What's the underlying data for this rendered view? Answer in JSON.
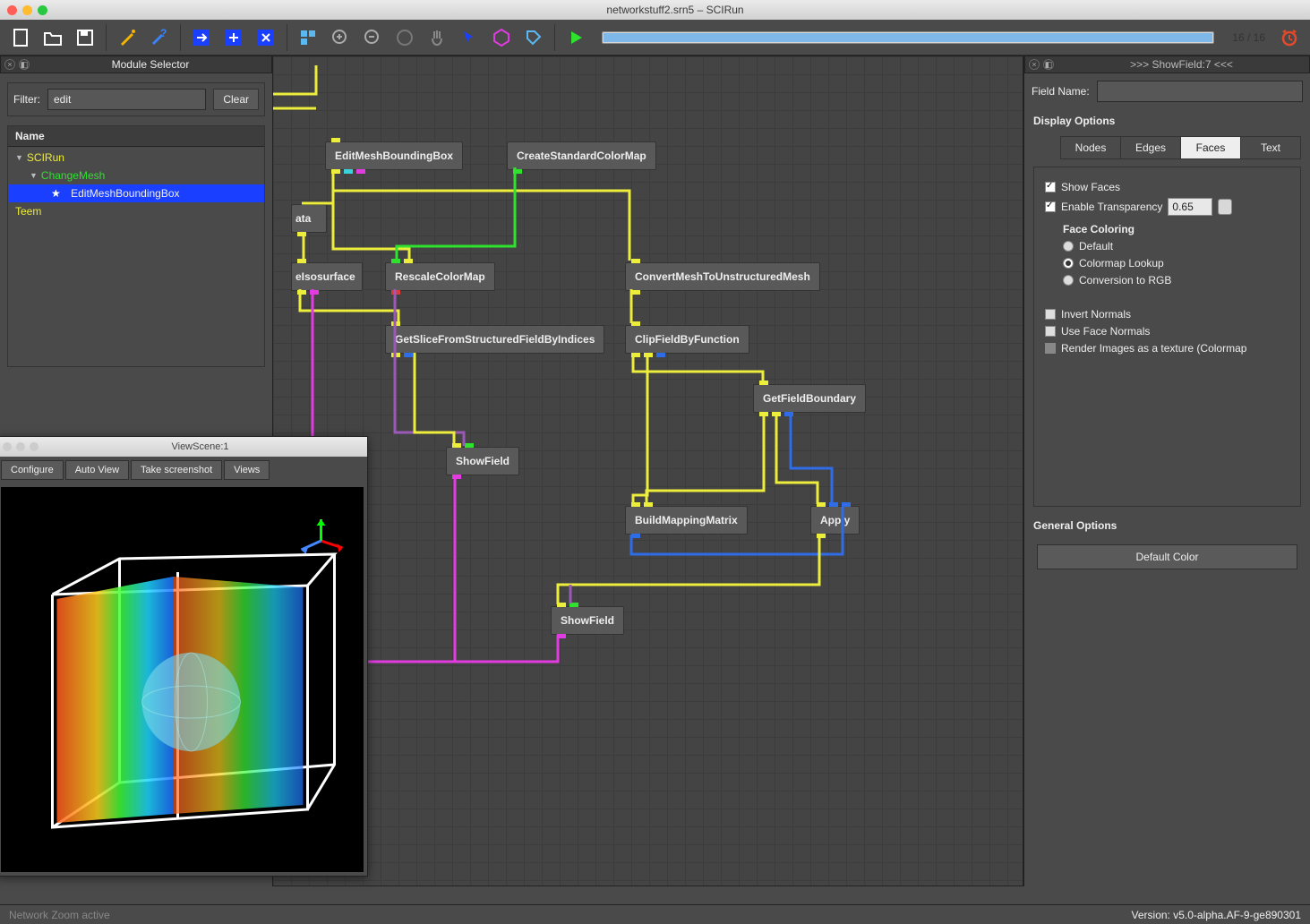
{
  "window": {
    "title": "networkstuff2.srn5 – SCIRun"
  },
  "progress": {
    "label": "16 / 16"
  },
  "module_selector": {
    "panel_title": "Module Selector",
    "filter_label": "Filter:",
    "filter_value": "edit",
    "clear_label": "Clear",
    "tree_header": "Name",
    "root": "SCIRun",
    "level1": "ChangeMesh",
    "selected": "EditMeshBoundingBox",
    "root2": "Teem"
  },
  "viewscene": {
    "title": "ViewScene:1",
    "configure": "Configure",
    "auto_view": "Auto View",
    "screenshot": "Take screenshot",
    "views": "Views"
  },
  "nodes": {
    "editmesh": "EditMeshBoundingBox",
    "colormap": "CreateStandardColorMap",
    "data": "ata",
    "iso": "eIsosurface",
    "rescale": "RescaleColorMap",
    "convert": "ConvertMeshToUnstructuredMesh",
    "getslice": "GetSliceFromStructuredFieldByIndices",
    "clip": "ClipFieldByFunction",
    "boundary": "GetFieldBoundary",
    "show1": "ShowField",
    "build": "BuildMappingMatrix",
    "apply": "Apply",
    "show2": "ShowField"
  },
  "showfield": {
    "panel_title": ">>> ShowField:7 <<<",
    "field_name_label": "Field Name:",
    "field_name_value": "",
    "display_options": "Display Options",
    "tabs": {
      "nodes": "Nodes",
      "edges": "Edges",
      "faces": "Faces",
      "text": "Text"
    },
    "show_faces": "Show Faces",
    "enable_transparency": "Enable Transparency",
    "transparency_value": "0.65",
    "face_coloring": "Face Coloring",
    "coloring_default": "Default",
    "coloring_colormap": "Colormap Lookup",
    "coloring_rgb": "Conversion to RGB",
    "invert_normals": "Invert Normals",
    "use_face_normals": "Use Face Normals",
    "render_texture": "Render Images as a texture (Colormap",
    "general_options": "General Options",
    "default_color": "Default Color"
  },
  "footer": {
    "status": "Network Zoom active",
    "version": "Version: v5.0-alpha.AF-9-ge890301"
  }
}
